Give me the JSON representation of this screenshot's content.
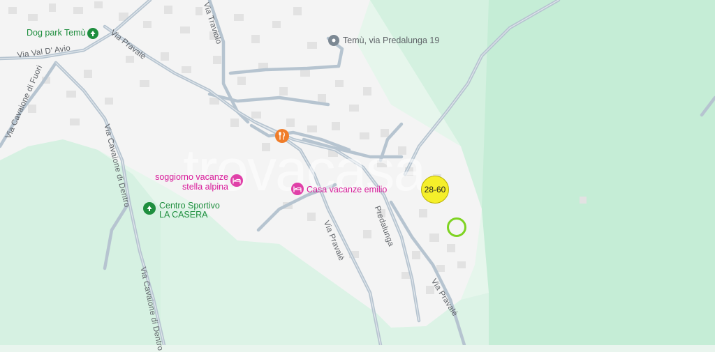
{
  "map": {
    "colors": {
      "background": "#e9f5ee",
      "urban_area": "#f4f4f4",
      "forest": "#cfeedd",
      "forest_dark": "#c2ebd3",
      "road": "#aebdca",
      "poi_green": "#1e8e3e",
      "poi_pink": "#d81b9a",
      "poi_orange": "#f07d2a",
      "cluster": "#f5ef2a",
      "ring": "#7ed321"
    },
    "roads": {
      "via_val_davio": "Via Val D' Avio",
      "via_pravale_top": "Via Pravalè",
      "via_pravale_middle": "Via Pravalè",
      "via_pravale_bottom": "Via Pravalè",
      "via_traviolo": "Via Traviolo",
      "via_cavaione_di_fuori": "Via Cavaione di Fuori",
      "via_cavaione_di_dentro_top": "Via Cavaione di Dentro",
      "via_cavaione_di_dentro_bottom": "Via Cavaione di Dentro",
      "via_predalunga": "Predalunga"
    },
    "pois": {
      "dog_park": {
        "label": "Dog park Temù",
        "icon": "tree-icon"
      },
      "address": {
        "label": "Temù, via Predalunga 19",
        "icon": "location-pin-icon"
      },
      "restaurant": {
        "icon": "fork-knife-icon"
      },
      "soggiorno": {
        "label_line1": "soggiorno vacanze",
        "label_line2": "stella alpina",
        "icon": "bed-icon"
      },
      "casa_vacanze": {
        "label": "Casa vacanze emilio",
        "icon": "bed-icon"
      },
      "centro_sportivo": {
        "label_line1": "Centro Sportivo",
        "label_line2": "LA CASERA",
        "icon": "tree-icon"
      }
    },
    "cluster_label": "28-60",
    "watermark": "trovacasa"
  }
}
